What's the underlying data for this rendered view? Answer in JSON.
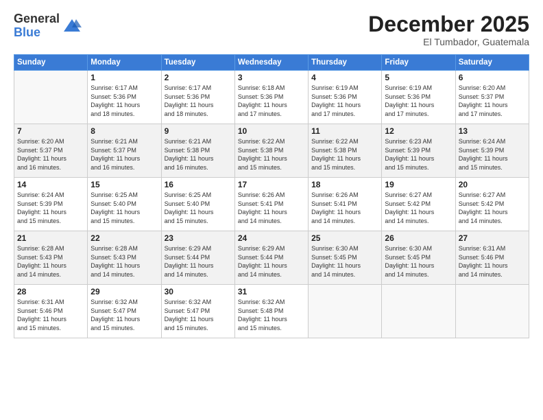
{
  "logo": {
    "general": "General",
    "blue": "Blue"
  },
  "title": "December 2025",
  "location": "El Tumbador, Guatemala",
  "weekdays": [
    "Sunday",
    "Monday",
    "Tuesday",
    "Wednesday",
    "Thursday",
    "Friday",
    "Saturday"
  ],
  "weeks": [
    [
      {
        "day": "",
        "info": ""
      },
      {
        "day": "1",
        "info": "Sunrise: 6:17 AM\nSunset: 5:36 PM\nDaylight: 11 hours\nand 18 minutes."
      },
      {
        "day": "2",
        "info": "Sunrise: 6:17 AM\nSunset: 5:36 PM\nDaylight: 11 hours\nand 18 minutes."
      },
      {
        "day": "3",
        "info": "Sunrise: 6:18 AM\nSunset: 5:36 PM\nDaylight: 11 hours\nand 17 minutes."
      },
      {
        "day": "4",
        "info": "Sunrise: 6:19 AM\nSunset: 5:36 PM\nDaylight: 11 hours\nand 17 minutes."
      },
      {
        "day": "5",
        "info": "Sunrise: 6:19 AM\nSunset: 5:36 PM\nDaylight: 11 hours\nand 17 minutes."
      },
      {
        "day": "6",
        "info": "Sunrise: 6:20 AM\nSunset: 5:37 PM\nDaylight: 11 hours\nand 17 minutes."
      }
    ],
    [
      {
        "day": "7",
        "info": "Sunrise: 6:20 AM\nSunset: 5:37 PM\nDaylight: 11 hours\nand 16 minutes."
      },
      {
        "day": "8",
        "info": "Sunrise: 6:21 AM\nSunset: 5:37 PM\nDaylight: 11 hours\nand 16 minutes."
      },
      {
        "day": "9",
        "info": "Sunrise: 6:21 AM\nSunset: 5:38 PM\nDaylight: 11 hours\nand 16 minutes."
      },
      {
        "day": "10",
        "info": "Sunrise: 6:22 AM\nSunset: 5:38 PM\nDaylight: 11 hours\nand 15 minutes."
      },
      {
        "day": "11",
        "info": "Sunrise: 6:22 AM\nSunset: 5:38 PM\nDaylight: 11 hours\nand 15 minutes."
      },
      {
        "day": "12",
        "info": "Sunrise: 6:23 AM\nSunset: 5:39 PM\nDaylight: 11 hours\nand 15 minutes."
      },
      {
        "day": "13",
        "info": "Sunrise: 6:24 AM\nSunset: 5:39 PM\nDaylight: 11 hours\nand 15 minutes."
      }
    ],
    [
      {
        "day": "14",
        "info": "Sunrise: 6:24 AM\nSunset: 5:39 PM\nDaylight: 11 hours\nand 15 minutes."
      },
      {
        "day": "15",
        "info": "Sunrise: 6:25 AM\nSunset: 5:40 PM\nDaylight: 11 hours\nand 15 minutes."
      },
      {
        "day": "16",
        "info": "Sunrise: 6:25 AM\nSunset: 5:40 PM\nDaylight: 11 hours\nand 15 minutes."
      },
      {
        "day": "17",
        "info": "Sunrise: 6:26 AM\nSunset: 5:41 PM\nDaylight: 11 hours\nand 14 minutes."
      },
      {
        "day": "18",
        "info": "Sunrise: 6:26 AM\nSunset: 5:41 PM\nDaylight: 11 hours\nand 14 minutes."
      },
      {
        "day": "19",
        "info": "Sunrise: 6:27 AM\nSunset: 5:42 PM\nDaylight: 11 hours\nand 14 minutes."
      },
      {
        "day": "20",
        "info": "Sunrise: 6:27 AM\nSunset: 5:42 PM\nDaylight: 11 hours\nand 14 minutes."
      }
    ],
    [
      {
        "day": "21",
        "info": "Sunrise: 6:28 AM\nSunset: 5:43 PM\nDaylight: 11 hours\nand 14 minutes."
      },
      {
        "day": "22",
        "info": "Sunrise: 6:28 AM\nSunset: 5:43 PM\nDaylight: 11 hours\nand 14 minutes."
      },
      {
        "day": "23",
        "info": "Sunrise: 6:29 AM\nSunset: 5:44 PM\nDaylight: 11 hours\nand 14 minutes."
      },
      {
        "day": "24",
        "info": "Sunrise: 6:29 AM\nSunset: 5:44 PM\nDaylight: 11 hours\nand 14 minutes."
      },
      {
        "day": "25",
        "info": "Sunrise: 6:30 AM\nSunset: 5:45 PM\nDaylight: 11 hours\nand 14 minutes."
      },
      {
        "day": "26",
        "info": "Sunrise: 6:30 AM\nSunset: 5:45 PM\nDaylight: 11 hours\nand 14 minutes."
      },
      {
        "day": "27",
        "info": "Sunrise: 6:31 AM\nSunset: 5:46 PM\nDaylight: 11 hours\nand 14 minutes."
      }
    ],
    [
      {
        "day": "28",
        "info": "Sunrise: 6:31 AM\nSunset: 5:46 PM\nDaylight: 11 hours\nand 15 minutes."
      },
      {
        "day": "29",
        "info": "Sunrise: 6:32 AM\nSunset: 5:47 PM\nDaylight: 11 hours\nand 15 minutes."
      },
      {
        "day": "30",
        "info": "Sunrise: 6:32 AM\nSunset: 5:47 PM\nDaylight: 11 hours\nand 15 minutes."
      },
      {
        "day": "31",
        "info": "Sunrise: 6:32 AM\nSunset: 5:48 PM\nDaylight: 11 hours\nand 15 minutes."
      },
      {
        "day": "",
        "info": ""
      },
      {
        "day": "",
        "info": ""
      },
      {
        "day": "",
        "info": ""
      }
    ]
  ]
}
